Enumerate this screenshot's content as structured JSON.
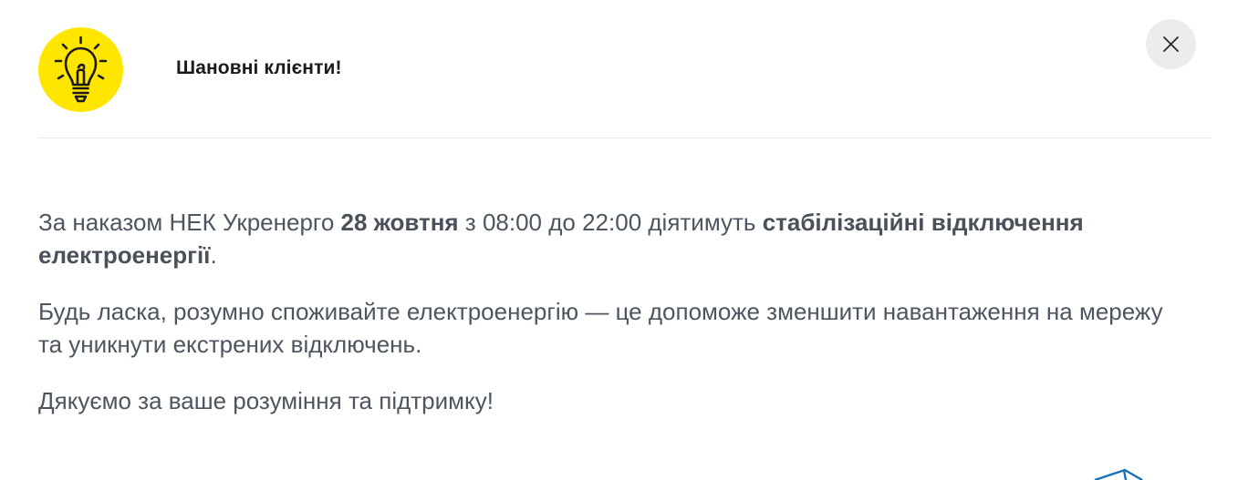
{
  "modal": {
    "icon": "lightbulb-icon",
    "icon_bg_color": "#ffe600",
    "title": "Шановні клієнти!",
    "close_icon": "close-icon"
  },
  "message": {
    "p1": {
      "part1": "За наказом НЕК Укренерго ",
      "bold1": "28 жовтня",
      "part2": " з 08:00 до 22:00 діятимуть ",
      "bold2": "стабілізаційні відключення електроенергії",
      "part3": "."
    },
    "p2": "Будь ласка, розумно споживайте електроенергію — це допоможе зменшити навантаження на мережу та уникнути екстрених відключень.",
    "p3": "Дякуємо за ваше розуміння та підтримку!"
  },
  "colors": {
    "text": "#4d5560",
    "title": "#1b1b1b",
    "accent": "#ffe600",
    "logo": "#1a6fb5"
  }
}
